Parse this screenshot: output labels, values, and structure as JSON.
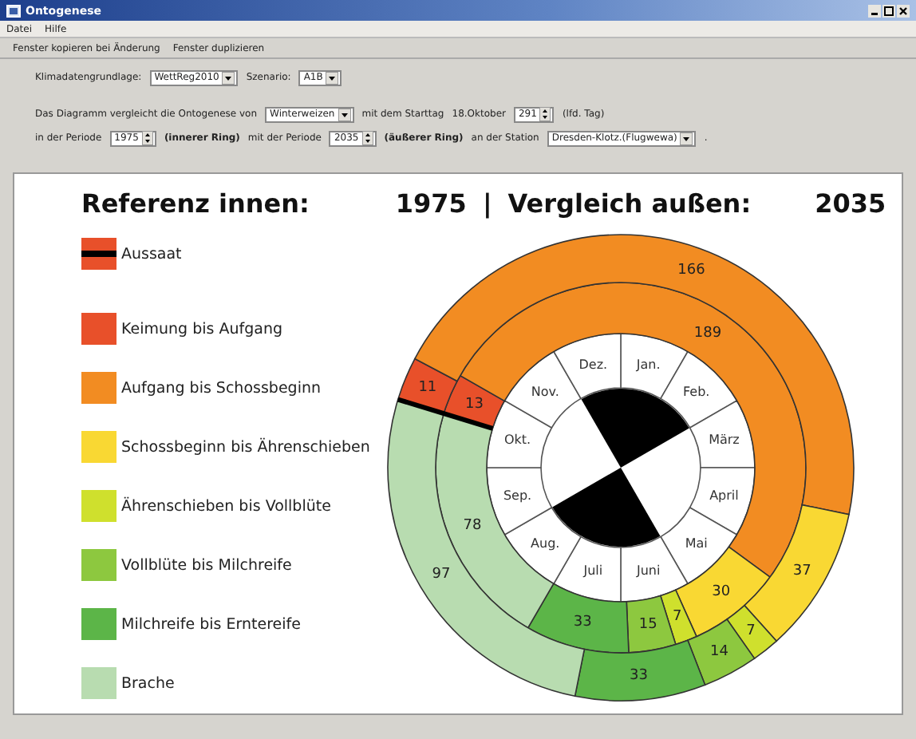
{
  "window": {
    "title": "Ontogenese"
  },
  "menu": [
    "Datei",
    "Hilfe"
  ],
  "toolbar": [
    "Fenster kopieren bei Änderung",
    "Fenster duplizieren"
  ],
  "settings": {
    "rows": [
      {
        "items": [
          {
            "kind": "label",
            "text": "Klimadatengrundlage:"
          },
          {
            "kind": "select",
            "value": "WettReg2010"
          },
          {
            "kind": "label",
            "text": "Szenario:"
          },
          {
            "kind": "select",
            "value": "A1B"
          }
        ]
      },
      {
        "items": [
          {
            "kind": "label",
            "text": "Das Diagramm vergleicht die Ontogenese von"
          },
          {
            "kind": "select",
            "value": "Winterweizen"
          },
          {
            "kind": "label",
            "text": "mit dem Starttag"
          },
          {
            "kind": "label",
            "text": "18.Oktober"
          },
          {
            "kind": "spinner",
            "value": "291"
          },
          {
            "kind": "label",
            "text": "(lfd. Tag)"
          }
        ]
      },
      {
        "items": [
          {
            "kind": "label",
            "text": "in der Periode"
          },
          {
            "kind": "spinner",
            "value": "1975"
          },
          {
            "kind": "bold",
            "text": "(innerer Ring)"
          },
          {
            "kind": "label",
            "text": "mit der Periode"
          },
          {
            "kind": "spinner",
            "value": "2035"
          },
          {
            "kind": "bold",
            "text": "(äußerer Ring)"
          },
          {
            "kind": "label",
            "text": "an der Station"
          },
          {
            "kind": "select",
            "value": "Dresden-Klotz.(Flugwewa)"
          },
          {
            "kind": "label",
            "text": "."
          }
        ]
      }
    ]
  },
  "chart": {
    "header": {
      "reference_label": "Referenz innen:",
      "separator": "|",
      "compare_label": "Vergleich außen:"
    },
    "sowing": {
      "label": "Aussaat",
      "color": "#000000"
    },
    "months": [
      "Jan.",
      "Feb.",
      "März",
      "April",
      "Mai",
      "Juni",
      "Juli",
      "Aug.",
      "Sep.",
      "Okt.",
      "Nov.",
      "Dez."
    ],
    "chart_data": {
      "type": "donut",
      "categories": [
        "Keimung bis Aufgang",
        "Aufgang bis Schossbeginn",
        "Schossbeginn bis Ährenschieben",
        "Ährenschieben bis Vollblüte",
        "Vollblüte bis Milchreife",
        "Milchreife bis Erntereife",
        "Brache"
      ],
      "series": [
        {
          "name": "1975",
          "colors": [
            "#e8502a",
            "#f28c22",
            "#f9d833",
            "#cfe02d",
            "#8dc83f",
            "#5cb548",
            "#b8dcb0"
          ],
          "values": [
            13,
            189,
            30,
            7,
            15,
            33,
            78
          ]
        },
        {
          "name": "2035",
          "colors": [
            "#e8502a",
            "#f28c22",
            "#f9d833",
            "#cfe02d",
            "#8dc83f",
            "#5cb548",
            "#b8dcb0"
          ],
          "values": [
            11,
            166,
            37,
            7,
            14,
            33,
            97
          ]
        }
      ],
      "data_labels": true
    }
  }
}
